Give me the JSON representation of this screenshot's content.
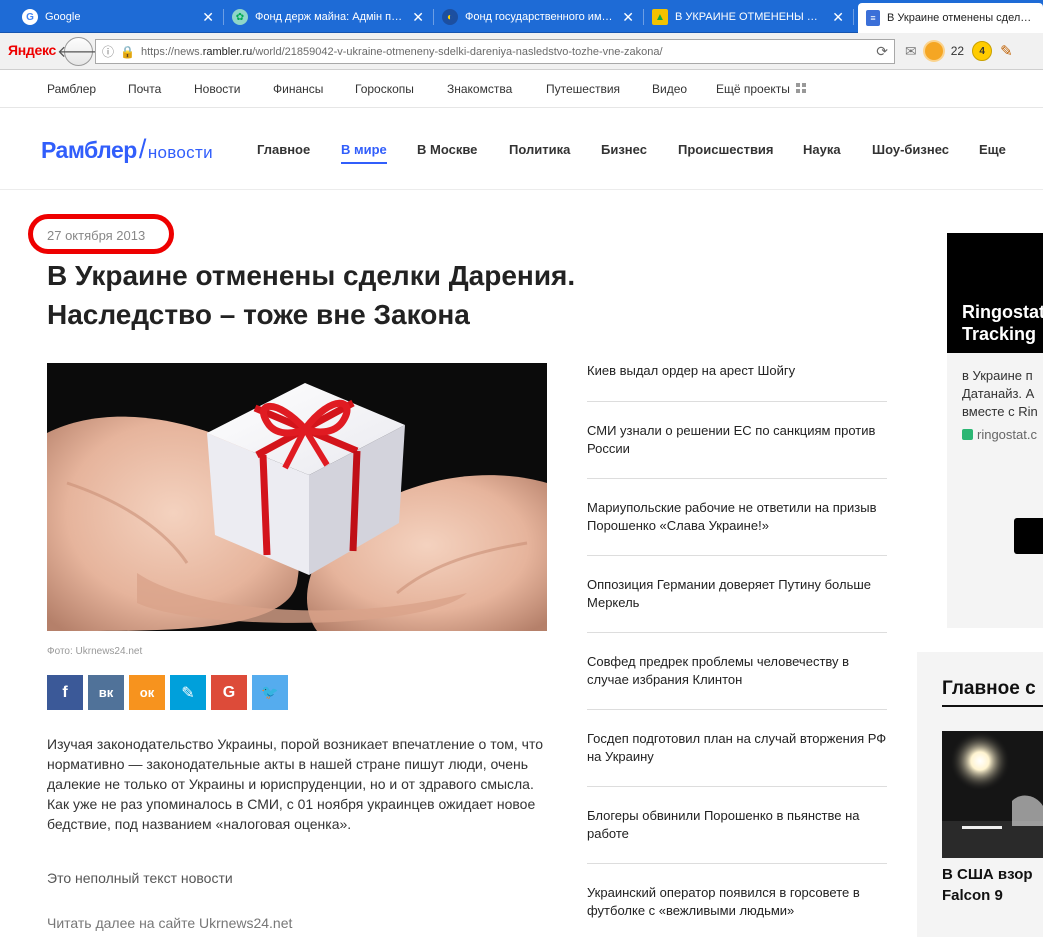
{
  "browser": {
    "tabs": [
      {
        "title": "Google",
        "icon": "google-icon"
      },
      {
        "title": "Фонд держ майна: Адмін па…",
        "icon": "globe-icon"
      },
      {
        "title": "Фонд государственного им…",
        "icon": "ukraine-seal-icon"
      },
      {
        "title": "В УКРАИНЕ ОТМЕНЕНЫ СДЕ…",
        "icon": "ukrnews-icon"
      },
      {
        "title": "В Украине отменены сделк…",
        "icon": "document-icon"
      }
    ],
    "brand": "Яндекс",
    "url_prefix": "https://news.",
    "url_host": "rambler.ru",
    "url_path": "/world/21859042-v-ukraine-otmeneny-sdelki-dareniya-nasledstvo-tozhe-vne-zakona/",
    "weather_temp": "22",
    "notif_count": "4"
  },
  "topnav": [
    "Рамблер",
    "Почта",
    "Новости",
    "Финансы",
    "Гороскопы",
    "Знакомства",
    "Путешествия",
    "Видео",
    "Ещё проекты"
  ],
  "header": {
    "logo_main": "Рамблер",
    "logo_slash": "/",
    "logo_section": "новости",
    "sections": [
      "Главное",
      "В мире",
      "В Москве",
      "Политика",
      "Бизнес",
      "Происшествия",
      "Наука",
      "Шоу-бизнес",
      "Еще"
    ],
    "active_section": "В мире"
  },
  "article": {
    "date": "27 октября 2013",
    "title": "В Украине отменены сделки Дарения. Наследство – тоже вне Закона",
    "photo_caption": "Фото: Ukrnews24.net",
    "body": "Изучая законодательство Украины, порой возникает впечатление о том, что нормативно — законодательные акты в нашей стране пишут люди, очень далекие не только от Украины и юриспруденции, но и от здравого смысла. Как уже не раз упоминалось в СМИ, с 01 ноября украинцев ожидает новое бедствие, под названием «налоговая оценка».",
    "partial_note": "Это неполный текст новости",
    "read_more": "Читать далее на сайте Ukrnews24.net"
  },
  "share": [
    {
      "name": "facebook",
      "glyph": "f",
      "color": "#3b5998"
    },
    {
      "name": "vkontakte",
      "glyph": "вк",
      "color": "#507299"
    },
    {
      "name": "odnoklassniki",
      "glyph": "ок",
      "color": "#f7931e"
    },
    {
      "name": "livejournal",
      "glyph": "✎",
      "color": "#00a0db"
    },
    {
      "name": "google-plus",
      "glyph": "G",
      "color": "#dd4b39"
    },
    {
      "name": "twitter",
      "glyph": "🐦",
      "color": "#55acee"
    }
  ],
  "related": [
    "Киев выдал ордер на арест Шойгу",
    "СМИ узнали о решении ЕС по санкциям против России",
    "Мариупольские рабочие не ответили на призыв Порошенко «Слава Украине!»",
    "Оппозиция Германии доверяет Путину больше Меркель",
    "Совфед предрек проблемы человечеству в случае избрания Клинтон",
    "Госдеп подготовил план на случай вторжения РФ на Украину",
    "Блогеры обвинили Порошенко в пьянстве на работе",
    "Украинский оператор появился в горсовете в футболке с «вежливыми людьми»"
  ],
  "ad": {
    "headline": "Ringostat Tracking",
    "text": "в Украине п Датанайз. А вместе с Rin",
    "site": "ringostat.c"
  },
  "main_block": {
    "title": "Главное с",
    "headline": "В США взор Falcon 9"
  }
}
